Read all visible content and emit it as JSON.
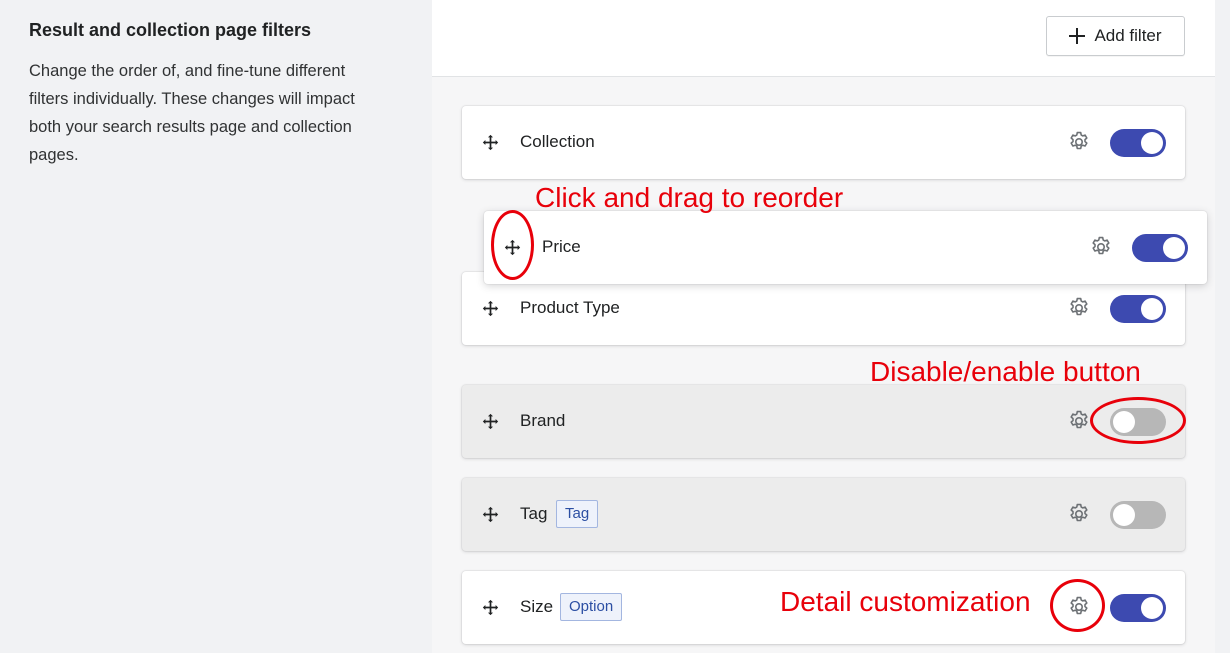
{
  "settings": {
    "title": "Result and collection page filters",
    "description": "Change the order of, and fine-tune different filters individually. These changes will impact both your search results page and collection pages."
  },
  "toolbar": {
    "add_filter_label": "Add filter"
  },
  "filters": [
    {
      "label": "Collection",
      "badge": "",
      "enabled": true
    },
    {
      "label": "Price",
      "badge": "",
      "enabled": true,
      "state": "dragging"
    },
    {
      "label": "Product Type",
      "badge": "",
      "enabled": true
    },
    {
      "label": "Brand",
      "badge": "",
      "enabled": false
    },
    {
      "label": "Tag",
      "badge": "Tag",
      "enabled": false
    },
    {
      "label": "Size",
      "badge": "Option",
      "enabled": true
    }
  ],
  "annotations": {
    "drag": "Click and drag to reorder",
    "toggle": "Disable/enable button",
    "gear": "Detail customization"
  },
  "colors": {
    "toggle_on": "#3d4ab0",
    "toggle_off": "#b7b7b7",
    "annotation": "#e8000a",
    "badge_text": "#2c4fa3"
  },
  "icons": [
    "plus-icon",
    "drag-handle-icon",
    "gear-icon",
    "toggle-switch"
  ]
}
